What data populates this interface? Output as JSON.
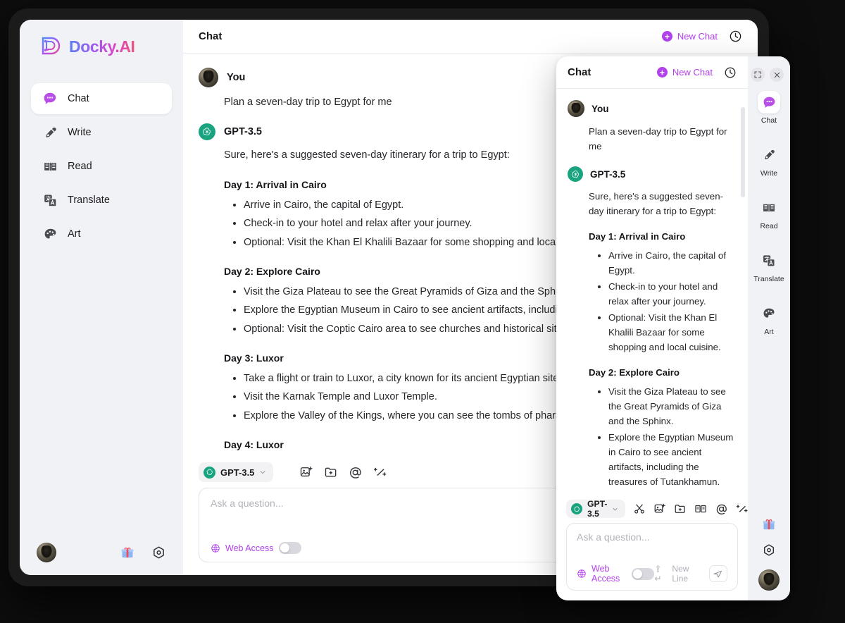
{
  "app": {
    "brand_name": "Docky.AI"
  },
  "sidebar": {
    "items": [
      {
        "label": "Chat",
        "icon": "chat-bubble-icon"
      },
      {
        "label": "Write",
        "icon": "pen-nib-icon"
      },
      {
        "label": "Read",
        "icon": "open-book-icon"
      },
      {
        "label": "Translate",
        "icon": "translate-icon"
      },
      {
        "label": "Art",
        "icon": "palette-icon"
      }
    ],
    "bottom": {
      "avatar": "user-avatar",
      "gift": "gift-icon",
      "settings": "settings-gear-icon"
    }
  },
  "main_window": {
    "header": {
      "title": "Chat",
      "new_chat": "New Chat",
      "history_icon": "clock-history-icon"
    },
    "conversation": {
      "user": {
        "name": "You",
        "text": "Plan a seven-day trip to Egypt for me"
      },
      "assistant": {
        "name": "GPT-3.5",
        "intro": "Sure, here's a suggested seven-day itinerary for a trip to Egypt:",
        "days": [
          {
            "title": "Day 1: Arrival in Cairo",
            "items": [
              "Arrive in Cairo, the capital of Egypt.",
              "Check-in to your hotel and relax after your journey.",
              "Optional: Visit the Khan El Khalili Bazaar for some shopping and local cuisine."
            ]
          },
          {
            "title": "Day 2: Explore Cairo",
            "items": [
              "Visit the Giza Plateau to see the Great Pyramids of Giza and the Sphinx.",
              "Explore the Egyptian Museum in Cairo to see ancient artifacts, including the treasures of Tutankhamun.",
              "Optional: Visit the Coptic Cairo area to see churches and historical sites."
            ]
          },
          {
            "title": "Day 3: Luxor",
            "items": [
              "Take a flight or train to Luxor, a city known for its ancient Egyptian sites.",
              "Visit the Karnak Temple and Luxor Temple.",
              "Explore the Valley of the Kings, where you can see the tombs of pharaohs."
            ]
          },
          {
            "title": "Day 4: Luxor",
            "items": []
          }
        ]
      }
    },
    "composer": {
      "model": "GPT-3.5",
      "tools": [
        "image-add-icon",
        "folder-add-icon",
        "mention-at-icon",
        "prompt-magic-icon"
      ],
      "placeholder": "Ask a question...",
      "web_access": "Web Access",
      "web_access_on": false
    }
  },
  "float_window": {
    "header": {
      "title": "Chat",
      "new_chat": "New Chat",
      "history_icon": "clock-history-icon"
    },
    "window_buttons": {
      "expand": "expand-icon",
      "close": "close-icon"
    },
    "conversation": {
      "user": {
        "name": "You",
        "text": "Plan a seven-day trip to Egypt for me"
      },
      "assistant": {
        "name": "GPT-3.5",
        "intro": "Sure, here's a suggested seven-day itinerary for a trip to Egypt:",
        "days": [
          {
            "title": "Day 1: Arrival in Cairo",
            "items": [
              "Arrive in Cairo, the capital of Egypt.",
              "Check-in to your hotel and relax after your journey.",
              "Optional: Visit the Khan El Khalili Bazaar for some shopping and local cuisine."
            ]
          },
          {
            "title": "Day 2: Explore Cairo",
            "items": [
              "Visit the Giza Plateau to see the Great Pyramids of Giza and the Sphinx.",
              "Explore the Egyptian Museum in Cairo to see ancient artifacts, including the treasures of Tutankhamun."
            ]
          }
        ]
      }
    },
    "composer": {
      "model": "GPT-3.5",
      "tools": [
        "scissors-icon",
        "image-add-icon",
        "folder-add-icon",
        "open-book-icon",
        "mention-at-icon",
        "prompt-magic-icon"
      ],
      "placeholder": "Ask a question...",
      "web_access": "Web Access",
      "web_access_on": false,
      "newline_hint": "New Line",
      "newline_keys": "⇧ ↵",
      "send_icon": "send-paper-plane-icon"
    },
    "rail": {
      "items": [
        {
          "label": "Chat",
          "icon": "chat-bubble-icon"
        },
        {
          "label": "Write",
          "icon": "pen-nib-icon"
        },
        {
          "label": "Read",
          "icon": "open-book-icon"
        },
        {
          "label": "Translate",
          "icon": "translate-icon"
        },
        {
          "label": "Art",
          "icon": "palette-icon"
        }
      ],
      "bottom": {
        "gift": "gift-icon",
        "settings": "settings-gear-icon",
        "avatar": "user-avatar"
      }
    }
  },
  "colors": {
    "accent": "#b341ec",
    "gpt_green": "#19a37f",
    "sidebar_bg": "#f1f2f6",
    "frame": "#1b1b1b"
  }
}
